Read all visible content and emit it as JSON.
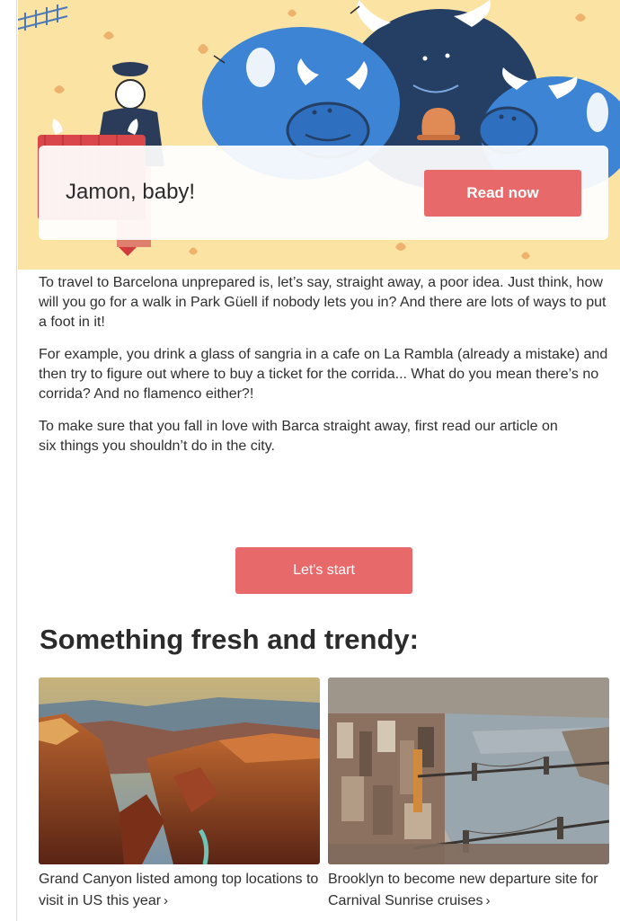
{
  "hero": {
    "title": "Jamon, baby!",
    "read_button": "Read now"
  },
  "article": {
    "paragraphs": [
      "To travel to Barcelona unprepared is, let’s say, straight away, a poor idea. Just think, how will you go for a walk in Park Güell if nobody lets you in? And there are lots of ways to put a foot in it!",
      "For example, you drink a glass of sangria in a cafe on La Rambla (already a mistake) and then try to figure out where to buy a ticket for the corrida... What do you mean there’s no corrida? And no flamenco either?!",
      "To make sure that you fall in love with Barca straight away, first read our article on six things you shouldn’t do in the city."
    ],
    "start_button": "Let's start"
  },
  "section": {
    "title": "Something fresh and trendy:"
  },
  "cards": [
    {
      "caption": "Grand Canyon listed among top locations to visit in US this year"
    },
    {
      "caption": "Brooklyn to become new departure site for Carnival Sunrise cruises"
    }
  ],
  "icons": {
    "chevron": "›"
  },
  "colors": {
    "accent": "#e8696a",
    "hero_bg": "#fbe3a4",
    "bull_blue": "#3d84d4",
    "bull_dark": "#243f63"
  }
}
